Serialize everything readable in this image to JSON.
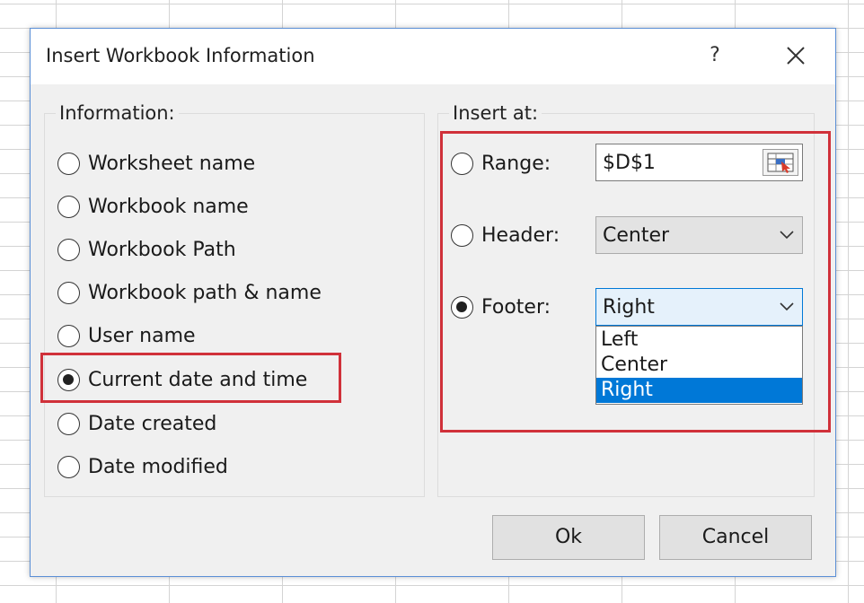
{
  "dialog": {
    "title": "Insert Workbook Information",
    "help_label": "?"
  },
  "information": {
    "legend": "Information:",
    "options": [
      {
        "label": "Worksheet name",
        "checked": false
      },
      {
        "label": "Workbook name",
        "checked": false
      },
      {
        "label": "Workbook Path",
        "checked": false
      },
      {
        "label": "Workbook path & name",
        "checked": false
      },
      {
        "label": "User name",
        "checked": false
      },
      {
        "label": "Current date and time",
        "checked": true
      },
      {
        "label": "Date created",
        "checked": false
      },
      {
        "label": "Date modified",
        "checked": false
      }
    ]
  },
  "insert_at": {
    "legend": "Insert at:",
    "range": {
      "label": "Range:",
      "value": "$D$1",
      "checked": false
    },
    "header": {
      "label": "Header:",
      "value": "Center",
      "checked": false
    },
    "footer": {
      "label": "Footer:",
      "value": "Right",
      "checked": true
    },
    "footer_options": [
      "Left",
      "Center",
      "Right"
    ],
    "footer_selected": "Right"
  },
  "buttons": {
    "ok": "Ok",
    "cancel": "Cancel"
  },
  "colors": {
    "highlight": "#d0313a",
    "selection": "#0078d7",
    "dialog_border": "#5b8fd6"
  }
}
